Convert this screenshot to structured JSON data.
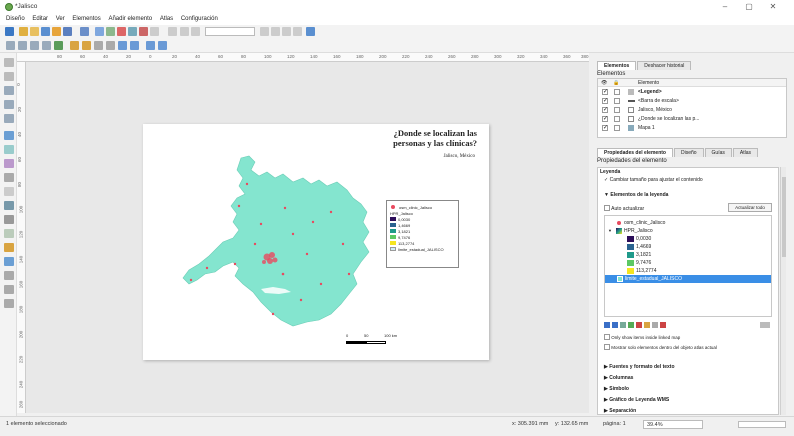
{
  "window": {
    "title": "*Jalisco",
    "minimize": "–",
    "maximize": "▢",
    "close": "✕"
  },
  "menu": [
    "Diseño",
    "Editar",
    "Ver",
    "Elementos",
    "Añadir elemento",
    "Atlas",
    "Configuración"
  ],
  "ruler": {
    "top_ticks": [
      "80",
      "60",
      "40",
      "20",
      "0",
      "20",
      "40",
      "60",
      "80",
      "100",
      "120",
      "140",
      "160",
      "180",
      "200",
      "220",
      "240",
      "260",
      "280",
      "300",
      "320",
      "340",
      "360",
      "380"
    ],
    "left_ticks": [
      "0",
      "20",
      "40",
      "60",
      "80",
      "100",
      "120",
      "140",
      "160",
      "180",
      "200",
      "220",
      "240",
      "260"
    ]
  },
  "map": {
    "title_line1": "¿Donde se localizan las",
    "title_line2": "personas y las clínicas?",
    "subtitle": "Jalisco, México",
    "fill_color": "#84e5cf",
    "legend": {
      "entries": [
        {
          "label": "osm_clinic_Jalisco",
          "color": "#e84a5f",
          "kind": "dot"
        },
        {
          "label": "HPR_Jalisco",
          "color": "",
          "kind": "header"
        },
        {
          "label": "0,0030",
          "color": "#2c0d59",
          "kind": "box"
        },
        {
          "label": "1,4669",
          "color": "#2a6390",
          "kind": "box"
        },
        {
          "label": "3,1821",
          "color": "#1f9a8a",
          "kind": "box"
        },
        {
          "label": "9,7476",
          "color": "#5cc864",
          "kind": "box"
        },
        {
          "label": "113,2774",
          "color": "#f5e51f",
          "kind": "box"
        },
        {
          "label": "limite_estadual_JALISCO",
          "color": "#cfeef5",
          "kind": "box"
        }
      ]
    },
    "scale": {
      "zero": "0",
      "mid": "50",
      "end": "100 km"
    }
  },
  "dock": {
    "tabs": [
      "Elementos",
      "Deshacer historial"
    ],
    "elements_heading": "Elementos",
    "elements_columns": {
      "eye": "👁",
      "lock": "🔒",
      "name": "Elemento"
    },
    "elements": [
      {
        "name": "<Legend>",
        "bold": true,
        "checked": true
      },
      {
        "name": "<Barra de escala>",
        "bold": false,
        "checked": true
      },
      {
        "name": "Jalisco, México",
        "bold": false,
        "checked": true
      },
      {
        "name": "¿Donde se localizan las p...",
        "bold": false,
        "checked": true
      },
      {
        "name": "Mapa 1",
        "bold": false,
        "checked": true
      }
    ],
    "prop_tabs": [
      "Propiedades del elemento",
      "Diseño",
      "Guías",
      "Atlas"
    ],
    "prop_heading": "Propiedades del elemento",
    "prop_type": "Leyenda",
    "resize_label": "Cambiar tamaño para ajustar el contenido",
    "section_elements": "Elementos de la leyenda",
    "auto_update": "Auto actualizar",
    "update_all": "Actualizar todo",
    "tree": [
      {
        "label": "osm_clinic_Jalisco",
        "indent": 1,
        "kind": "dot",
        "color": "#e84a5f",
        "selected": false
      },
      {
        "label": "HPR_Jalisco",
        "indent": 1,
        "kind": "layer",
        "color": "#2a6390",
        "selected": false
      },
      {
        "label": "0,0030",
        "indent": 2,
        "kind": "box",
        "color": "#2c0d59",
        "selected": false
      },
      {
        "label": "1,4669",
        "indent": 2,
        "kind": "box",
        "color": "#2a6390",
        "selected": false
      },
      {
        "label": "3,1821",
        "indent": 2,
        "kind": "box",
        "color": "#1f9a8a",
        "selected": false
      },
      {
        "label": "9,7476",
        "indent": 2,
        "kind": "box",
        "color": "#5cc864",
        "selected": false
      },
      {
        "label": "113,2774",
        "indent": 2,
        "kind": "box",
        "color": "#f5e51f",
        "selected": false
      },
      {
        "label": "limite_estadual_JALISCO",
        "indent": 1,
        "kind": "box",
        "color": "#84e5cf",
        "selected": true
      }
    ],
    "only_show": "Only show items inside linked map",
    "show_atlas": "Mostrar solo elementos dentro del objeto atlas actual",
    "sections": [
      "Fuentes y formato del texto",
      "Columnas",
      "Símbolo",
      "Gráfico de Leyenda WMS",
      "Separación"
    ]
  },
  "status": {
    "left": "1 elemento seleccionado",
    "x": "x: 305.391 mm",
    "y": "y: 132.65 mm",
    "page": "página: 1",
    "zoom": "39.4%"
  }
}
